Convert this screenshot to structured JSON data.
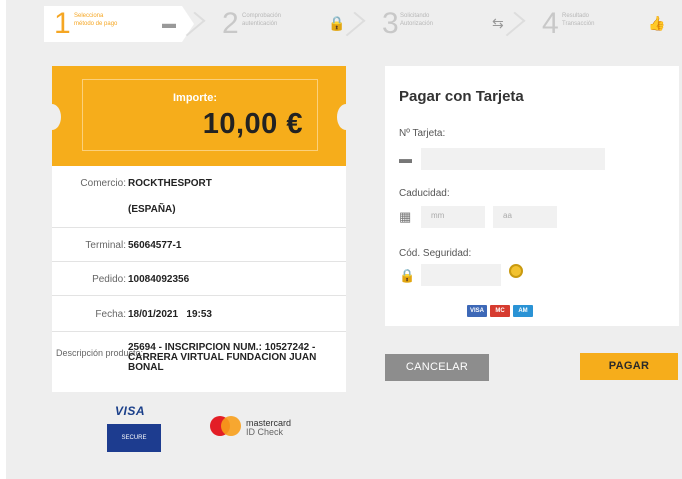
{
  "steps": [
    {
      "num": "1",
      "line1": "Selecciona",
      "line2": "método de pago",
      "icon": "card-icon",
      "glyph": "▬"
    },
    {
      "num": "2",
      "line1": "Comprobación",
      "line2": "autenticación",
      "icon": "lock-icon",
      "glyph": "🔒"
    },
    {
      "num": "3",
      "line1": "Solicitando",
      "line2": "Autorización",
      "icon": "exchange-icon",
      "glyph": "⇆"
    },
    {
      "num": "4",
      "line1": "Resultado",
      "line2": "Transacción",
      "icon": "thumbs-up-icon",
      "glyph": "👍"
    }
  ],
  "amount": {
    "label": "Importe:",
    "value": "10,00 €"
  },
  "details": {
    "comercio_label": "Comercio:",
    "comercio_value": "ROCKTHESPORT",
    "comercio_value2": "(ESPAÑA)",
    "terminal_label": "Terminal:",
    "terminal_value": "56064577-1",
    "pedido_label": "Pedido:",
    "pedido_value": "10084092356",
    "fecha_label": "Fecha:",
    "fecha_value": "18/01/2021   19:53",
    "descripcion_label": "Descripción producto:",
    "descripcion_value": "25694 - INSCRIPCION NUM.: 10527242 - CARRERA VIRTUAL FUNDACION JUAN BONAL"
  },
  "logos": {
    "visa_text": "VISA",
    "visa_sub": "SECURE",
    "mc_line1": "mastercard",
    "mc_line2": "ID Check"
  },
  "card_form": {
    "title": "Pagar con Tarjeta",
    "card_number_label": "Nº Tarjeta:",
    "expiry_label": "Caducidad:",
    "month_placeholder": "mm",
    "year_placeholder": "aa",
    "cvv_label": "Cód. Seguridad:",
    "brand_icons": [
      "VISA",
      "MC",
      "AM"
    ]
  },
  "buttons": {
    "cancel": "CANCELAR",
    "pay": "PAGAR"
  },
  "colors": {
    "accent": "#f6ad1b",
    "cancel": "#8d8d8d",
    "background": "#eeeeee"
  }
}
